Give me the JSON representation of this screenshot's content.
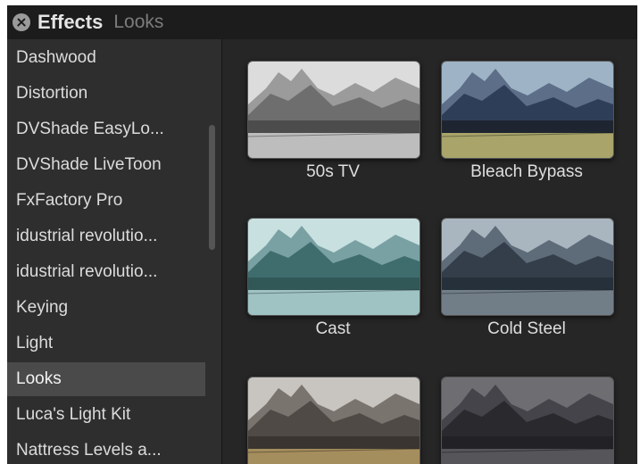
{
  "window": {
    "title": "Effects",
    "subtitle": "Looks"
  },
  "categories": [
    "Dashwood",
    "Distortion",
    "DVShade EasyLo...",
    "DVShade LiveToon",
    "FxFactory Pro",
    "idustrial revolutio...",
    "idustrial revolutio...",
    "Keying",
    "Light",
    "Looks",
    "Luca's Light Kit",
    "Nattress Levels a..."
  ],
  "selected_category": "Looks",
  "effects": [
    {
      "label": "50s TV",
      "sky": "#dcdcdc",
      "mountain": "#6e6e6e",
      "mountainFar": "#9b9b9b",
      "water": "#4c4c4c",
      "grass": "#bdbdbd"
    },
    {
      "label": "Bleach Bypass",
      "sky": "#9eb4c6",
      "mountain": "#2f3e58",
      "mountainFar": "#5c6e88",
      "water": "#1e2530",
      "grass": "#a8a46a"
    },
    {
      "label": "Cast",
      "sky": "#c9e0e0",
      "mountain": "#3f6c6c",
      "mountainFar": "#79a1a3",
      "water": "#325757",
      "grass": "#9fc3c3"
    },
    {
      "label": "Cold Steel",
      "sky": "#a9b6c0",
      "mountain": "#333e4a",
      "mountainFar": "#5e6b78",
      "water": "#25303a",
      "grass": "#717e88"
    },
    {
      "label": "",
      "sky": "#c8c4bf",
      "mountain": "#4f4a46",
      "mountainFar": "#7a746e",
      "water": "#3a3530",
      "grass": "#a58e5e"
    },
    {
      "label": "",
      "sky": "#6e6e72",
      "mountain": "#2a2a2e",
      "mountainFar": "#44444a",
      "water": "#222226",
      "grass": "#55555a"
    }
  ]
}
